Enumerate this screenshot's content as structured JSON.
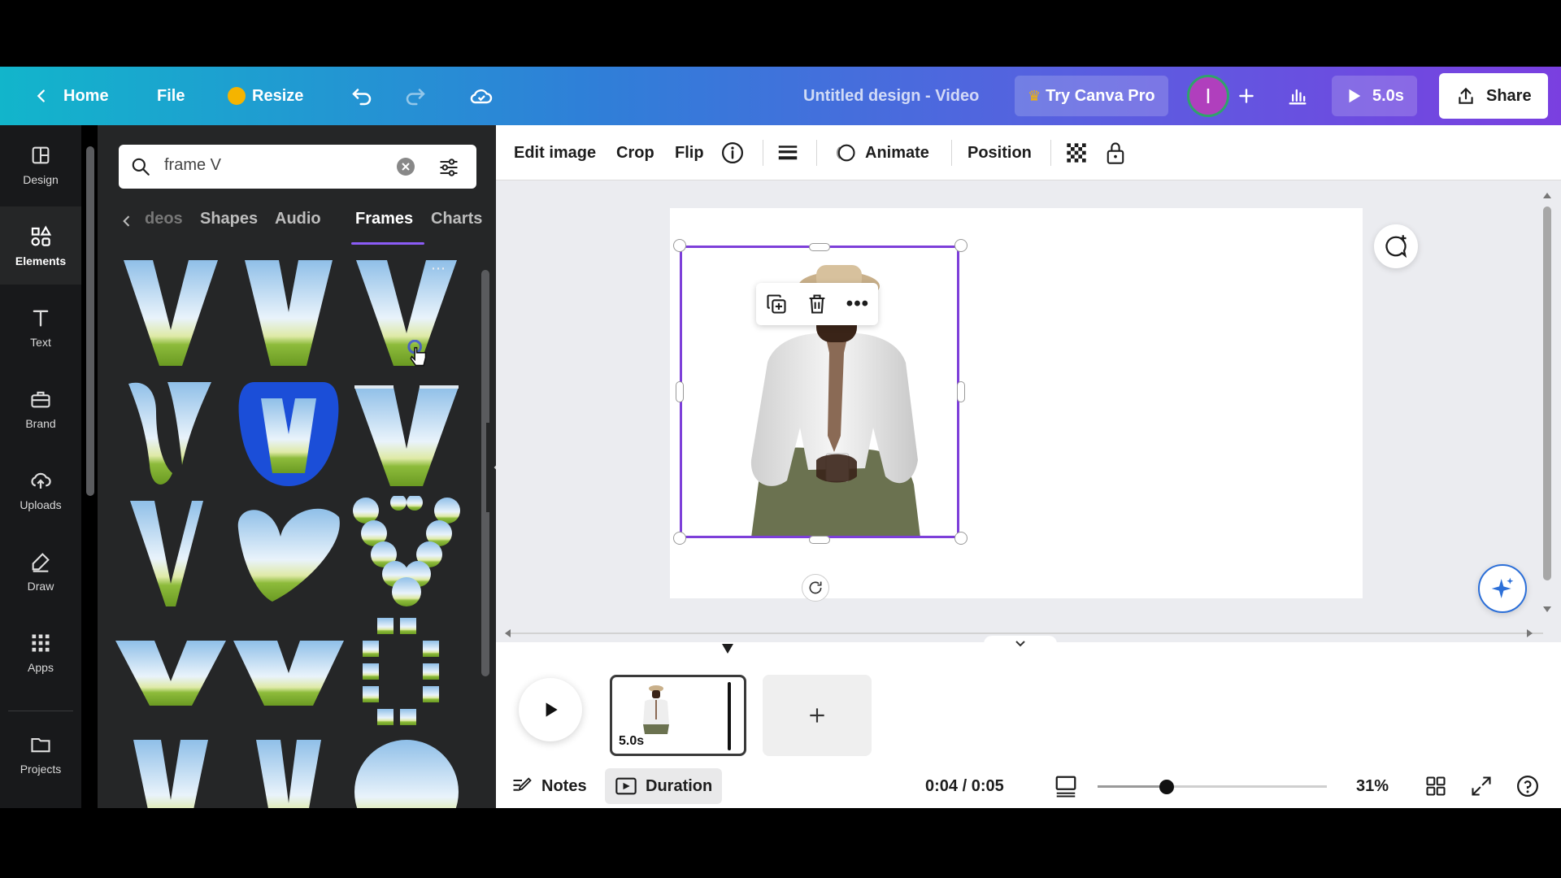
{
  "topbar": {
    "home_label": "Home",
    "file_label": "File",
    "resize_label": "Resize",
    "title": "Untitled design - Video",
    "try_pro_label": "Try Canva Pro",
    "avatar_initial": "I",
    "play_duration": "5.0s",
    "share_label": "Share"
  },
  "rail": {
    "items": [
      {
        "label": "Design",
        "icon": "layout-icon"
      },
      {
        "label": "Elements",
        "icon": "shapes-icon"
      },
      {
        "label": "Text",
        "icon": "text-icon"
      },
      {
        "label": "Brand",
        "icon": "briefcase-icon"
      },
      {
        "label": "Uploads",
        "icon": "cloud-upload-icon"
      },
      {
        "label": "Draw",
        "icon": "pen-icon"
      },
      {
        "label": "Apps",
        "icon": "apps-grid-icon"
      },
      {
        "label": "Projects",
        "icon": "folder-icon"
      }
    ]
  },
  "panel": {
    "search_value": "frame V",
    "tabs": [
      "deos",
      "Shapes",
      "Audio",
      "Frames",
      "Charts"
    ],
    "active_tab": "Frames"
  },
  "toolbar": {
    "edit_image": "Edit image",
    "crop": "Crop",
    "flip": "Flip",
    "animate": "Animate",
    "position": "Position"
  },
  "timeline": {
    "clip_duration": "5.0s",
    "notes_label": "Notes",
    "duration_label": "Duration",
    "time_readout": "0:04 / 0:05",
    "zoom": "31%",
    "zoom_fraction": 0.3
  },
  "colors": {
    "accent": "#7d3fd9",
    "frame_blue": "#1b4ed8"
  }
}
